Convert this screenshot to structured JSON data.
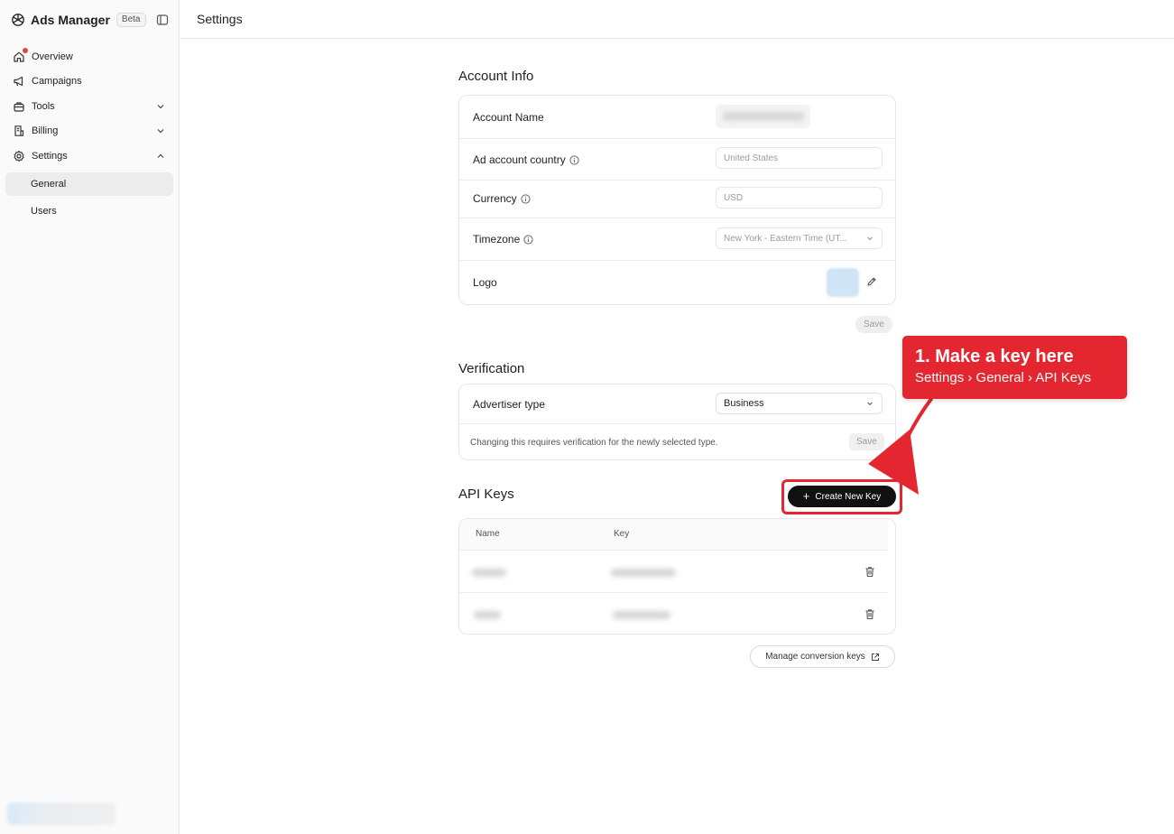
{
  "app": {
    "name": "Ads Manager",
    "badge": "Beta"
  },
  "sidebar": {
    "items": [
      {
        "label": "Overview",
        "icon": "home-icon"
      },
      {
        "label": "Campaigns",
        "icon": "megaphone-icon"
      },
      {
        "label": "Tools",
        "icon": "toolbox-icon"
      },
      {
        "label": "Billing",
        "icon": "billing-icon"
      },
      {
        "label": "Settings",
        "icon": "gear-icon"
      }
    ],
    "sub_items": [
      {
        "label": "General",
        "active": true
      },
      {
        "label": "Users",
        "active": false
      }
    ]
  },
  "header": {
    "title": "Settings"
  },
  "account_info": {
    "title": "Account Info",
    "rows": [
      {
        "label": "Account Name",
        "value": ""
      },
      {
        "label": "Ad account country",
        "value": "United States"
      },
      {
        "label": "Currency",
        "value": "USD"
      },
      {
        "label": "Timezone",
        "value": "New York - Eastern Time (UT..."
      },
      {
        "label": "Logo",
        "value": ""
      }
    ],
    "save_label": "Save"
  },
  "verification": {
    "title": "Verification",
    "advertiser_type_label": "Advertiser type",
    "advertiser_type_value": "Business",
    "note": "Changing this requires verification for the newly selected type.",
    "save_label": "Save"
  },
  "api_keys": {
    "title": "API Keys",
    "create_label": "Create New Key",
    "columns": [
      "Name",
      "Key"
    ],
    "manage_label": "Manage conversion keys"
  },
  "callout": {
    "title": "1. Make a key here",
    "subtitle": "Settings › General › API Keys"
  },
  "colors": {
    "accent": "#e3262f",
    "button_dark": "#111111",
    "notification": "#e0483e"
  }
}
